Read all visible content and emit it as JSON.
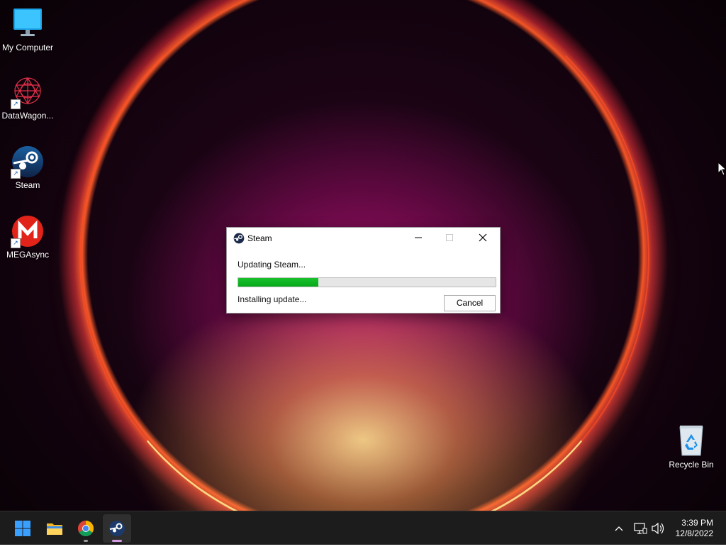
{
  "desktop": {
    "icons": [
      {
        "label": "My Computer",
        "icon": "monitor-icon"
      },
      {
        "label": "DataWagon...",
        "icon": "datawagon-icon"
      },
      {
        "label": "Steam",
        "icon": "steam-icon"
      },
      {
        "label": "MEGAsync",
        "icon": "mega-icon"
      },
      {
        "label": "Recycle Bin",
        "icon": "recycle-bin-icon"
      }
    ]
  },
  "dialog": {
    "title": "Steam",
    "status": "Updating Steam...",
    "detail": "Installing update...",
    "progress": 0.31,
    "cancel_label": "Cancel",
    "progress_color": "#10b824"
  },
  "taskbar": {
    "apps": [
      "start-icon",
      "file-explorer-icon",
      "chrome-icon",
      "steam-icon"
    ],
    "time": "3:39 PM",
    "date": "12/8/2022",
    "tray_icons": [
      "chevron-up-icon",
      "network-icon",
      "speaker-icon"
    ]
  }
}
